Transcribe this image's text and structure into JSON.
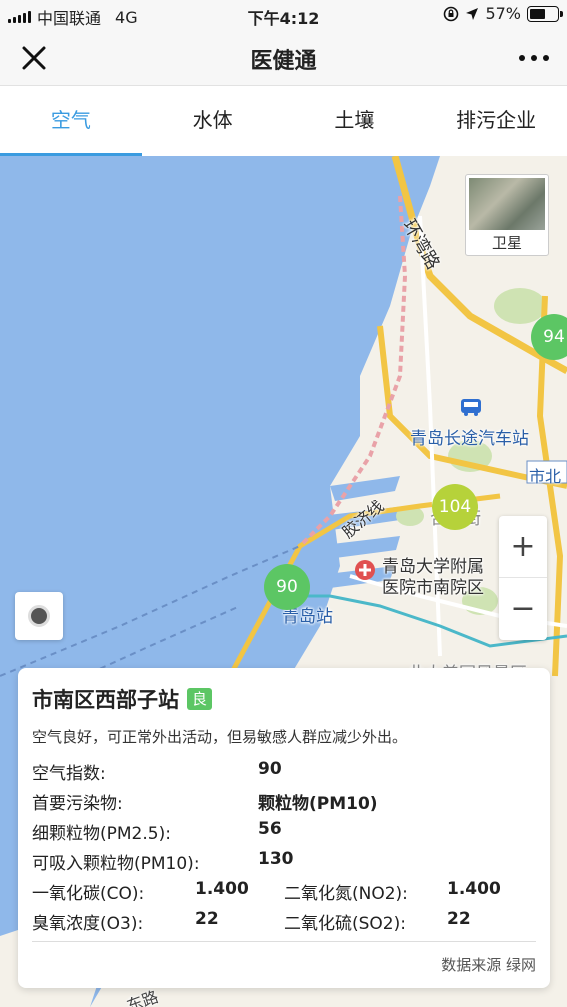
{
  "status_bar": {
    "carrier": "中国联通",
    "network": "4G",
    "time": "下午4:12",
    "battery": "57%",
    "battery_level": 0.57
  },
  "nav": {
    "title": "医健通",
    "close_icon": "close-icon",
    "more_icon": "more-icon"
  },
  "tabs": [
    {
      "label": "空气",
      "active": true
    },
    {
      "label": "水体",
      "active": false
    },
    {
      "label": "土壤",
      "active": false
    },
    {
      "label": "排污企业",
      "active": false
    }
  ],
  "map": {
    "satellite_label": "卫星",
    "zoom_in": "+",
    "zoom_out": "−",
    "labels": {
      "highway": "环湾路",
      "bus_station": "青岛长途汽车站",
      "district": "市北",
      "rail": "胶济线",
      "hospital_line1": "青岛大学附属",
      "hospital_line2": "医院市南院区",
      "station": "青岛站",
      "partial_south": "此大美园风景区",
      "partial_north": "合行街",
      "road_bottom": "东路"
    },
    "clusters": [
      {
        "value": "94",
        "color": "#5cc664"
      },
      {
        "value": "104",
        "color": "#b6d23a"
      },
      {
        "value": "90",
        "color": "#5cc664"
      }
    ]
  },
  "station_card": {
    "name": "市南区西部子站",
    "grade": "良",
    "grade_color": "#5cc664",
    "advice": "空气良好，可正常外出活动，但易敏感人群应减少外出。",
    "aqi_label": "空气指数:",
    "aqi_value": "90",
    "primary_label": "首要污染物:",
    "primary_value": "颗粒物(PM10)",
    "pm25_label": "细颗粒物(PM2.5):",
    "pm25_value": "56",
    "pm10_label": "可吸入颗粒物(PM10):",
    "pm10_value": "130",
    "co_label": "一氧化碳(CO):",
    "co_value": "1.400",
    "no2_label": "二氧化氮(NO2):",
    "no2_value": "1.400",
    "o3_label": "臭氧浓度(O3):",
    "o3_value": "22",
    "so2_label": "二氧化硫(SO2):",
    "so2_value": "22",
    "source": "数据来源 绿网"
  }
}
